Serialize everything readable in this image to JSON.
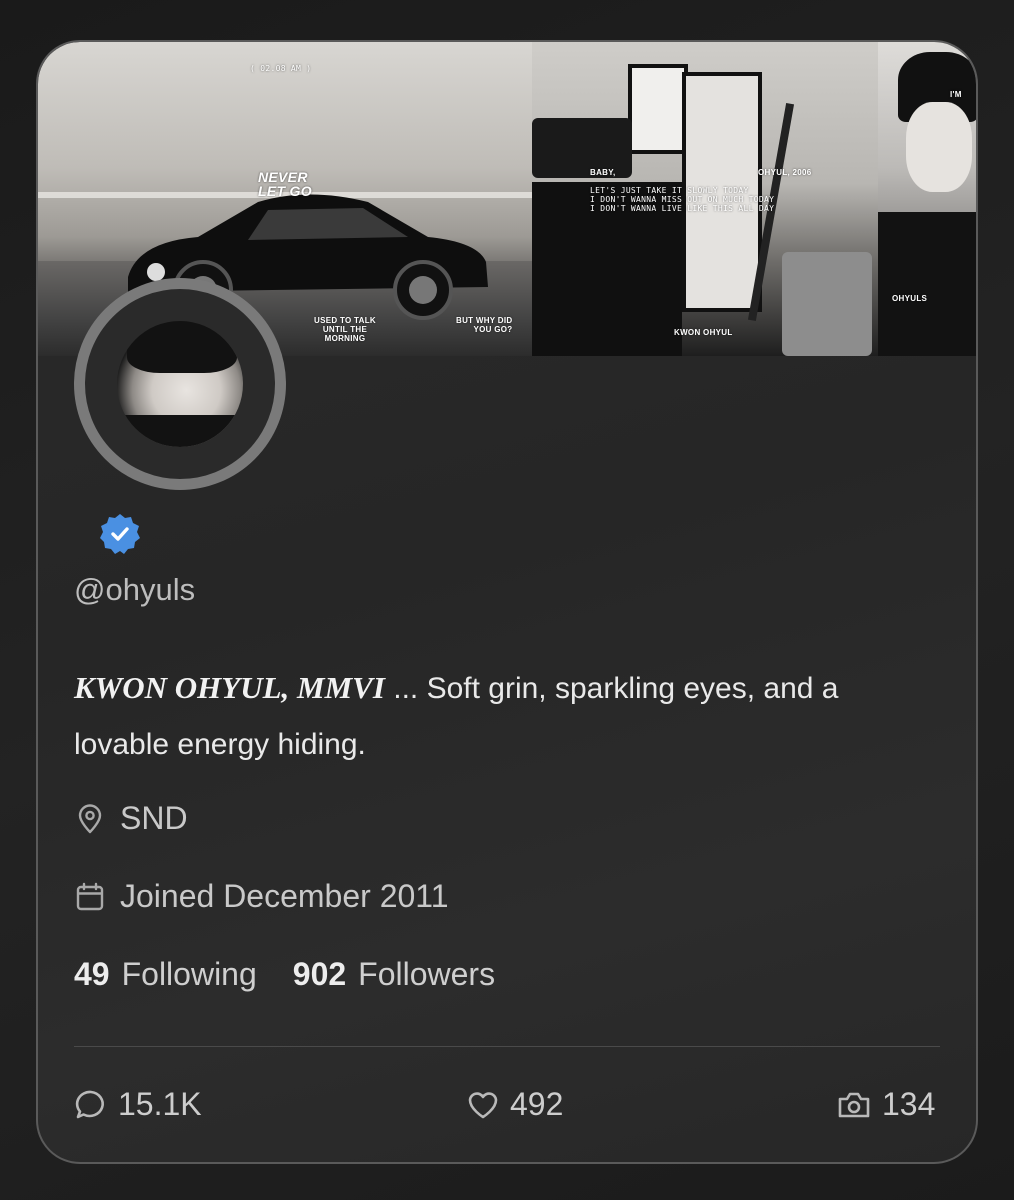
{
  "banner": {
    "time_tag": "( 02.08 AM )",
    "never_let_go": "NEVER\nLET GO",
    "used_to_talk": "USED TO TALK\nUNTIL THE\nMORNING",
    "but_why": "BUT WHY DID\nYOU GO?",
    "baby": "BABY,",
    "ohyul_year": "OHYUL, 2006",
    "lyrics": "LET'S JUST TAKE IT SLOWLY TODAY\nI DON'T WANNA MISS OUT ON MUCH TODAY\nI DON'T WANNA LIVE LIKE THIS ALL DAY",
    "kwon_ohyul": "KWON OHYUL",
    "im": "I'M",
    "ohyuls": "OHYULS"
  },
  "profile": {
    "handle": "@ohyuls",
    "bio_name": "KWON OHYUL, MMVI",
    "bio_text": " ... Soft grin, sparkling eyes, and a lovable energy hiding.",
    "location": "SND",
    "joined": "Joined December 2011",
    "following_count": "49",
    "following_label": "Following",
    "followers_count": "902",
    "followers_label": "Followers",
    "verified_color": "#4a90e2"
  },
  "stats": {
    "replies": "15.1K",
    "likes": "492",
    "photos": "134"
  }
}
